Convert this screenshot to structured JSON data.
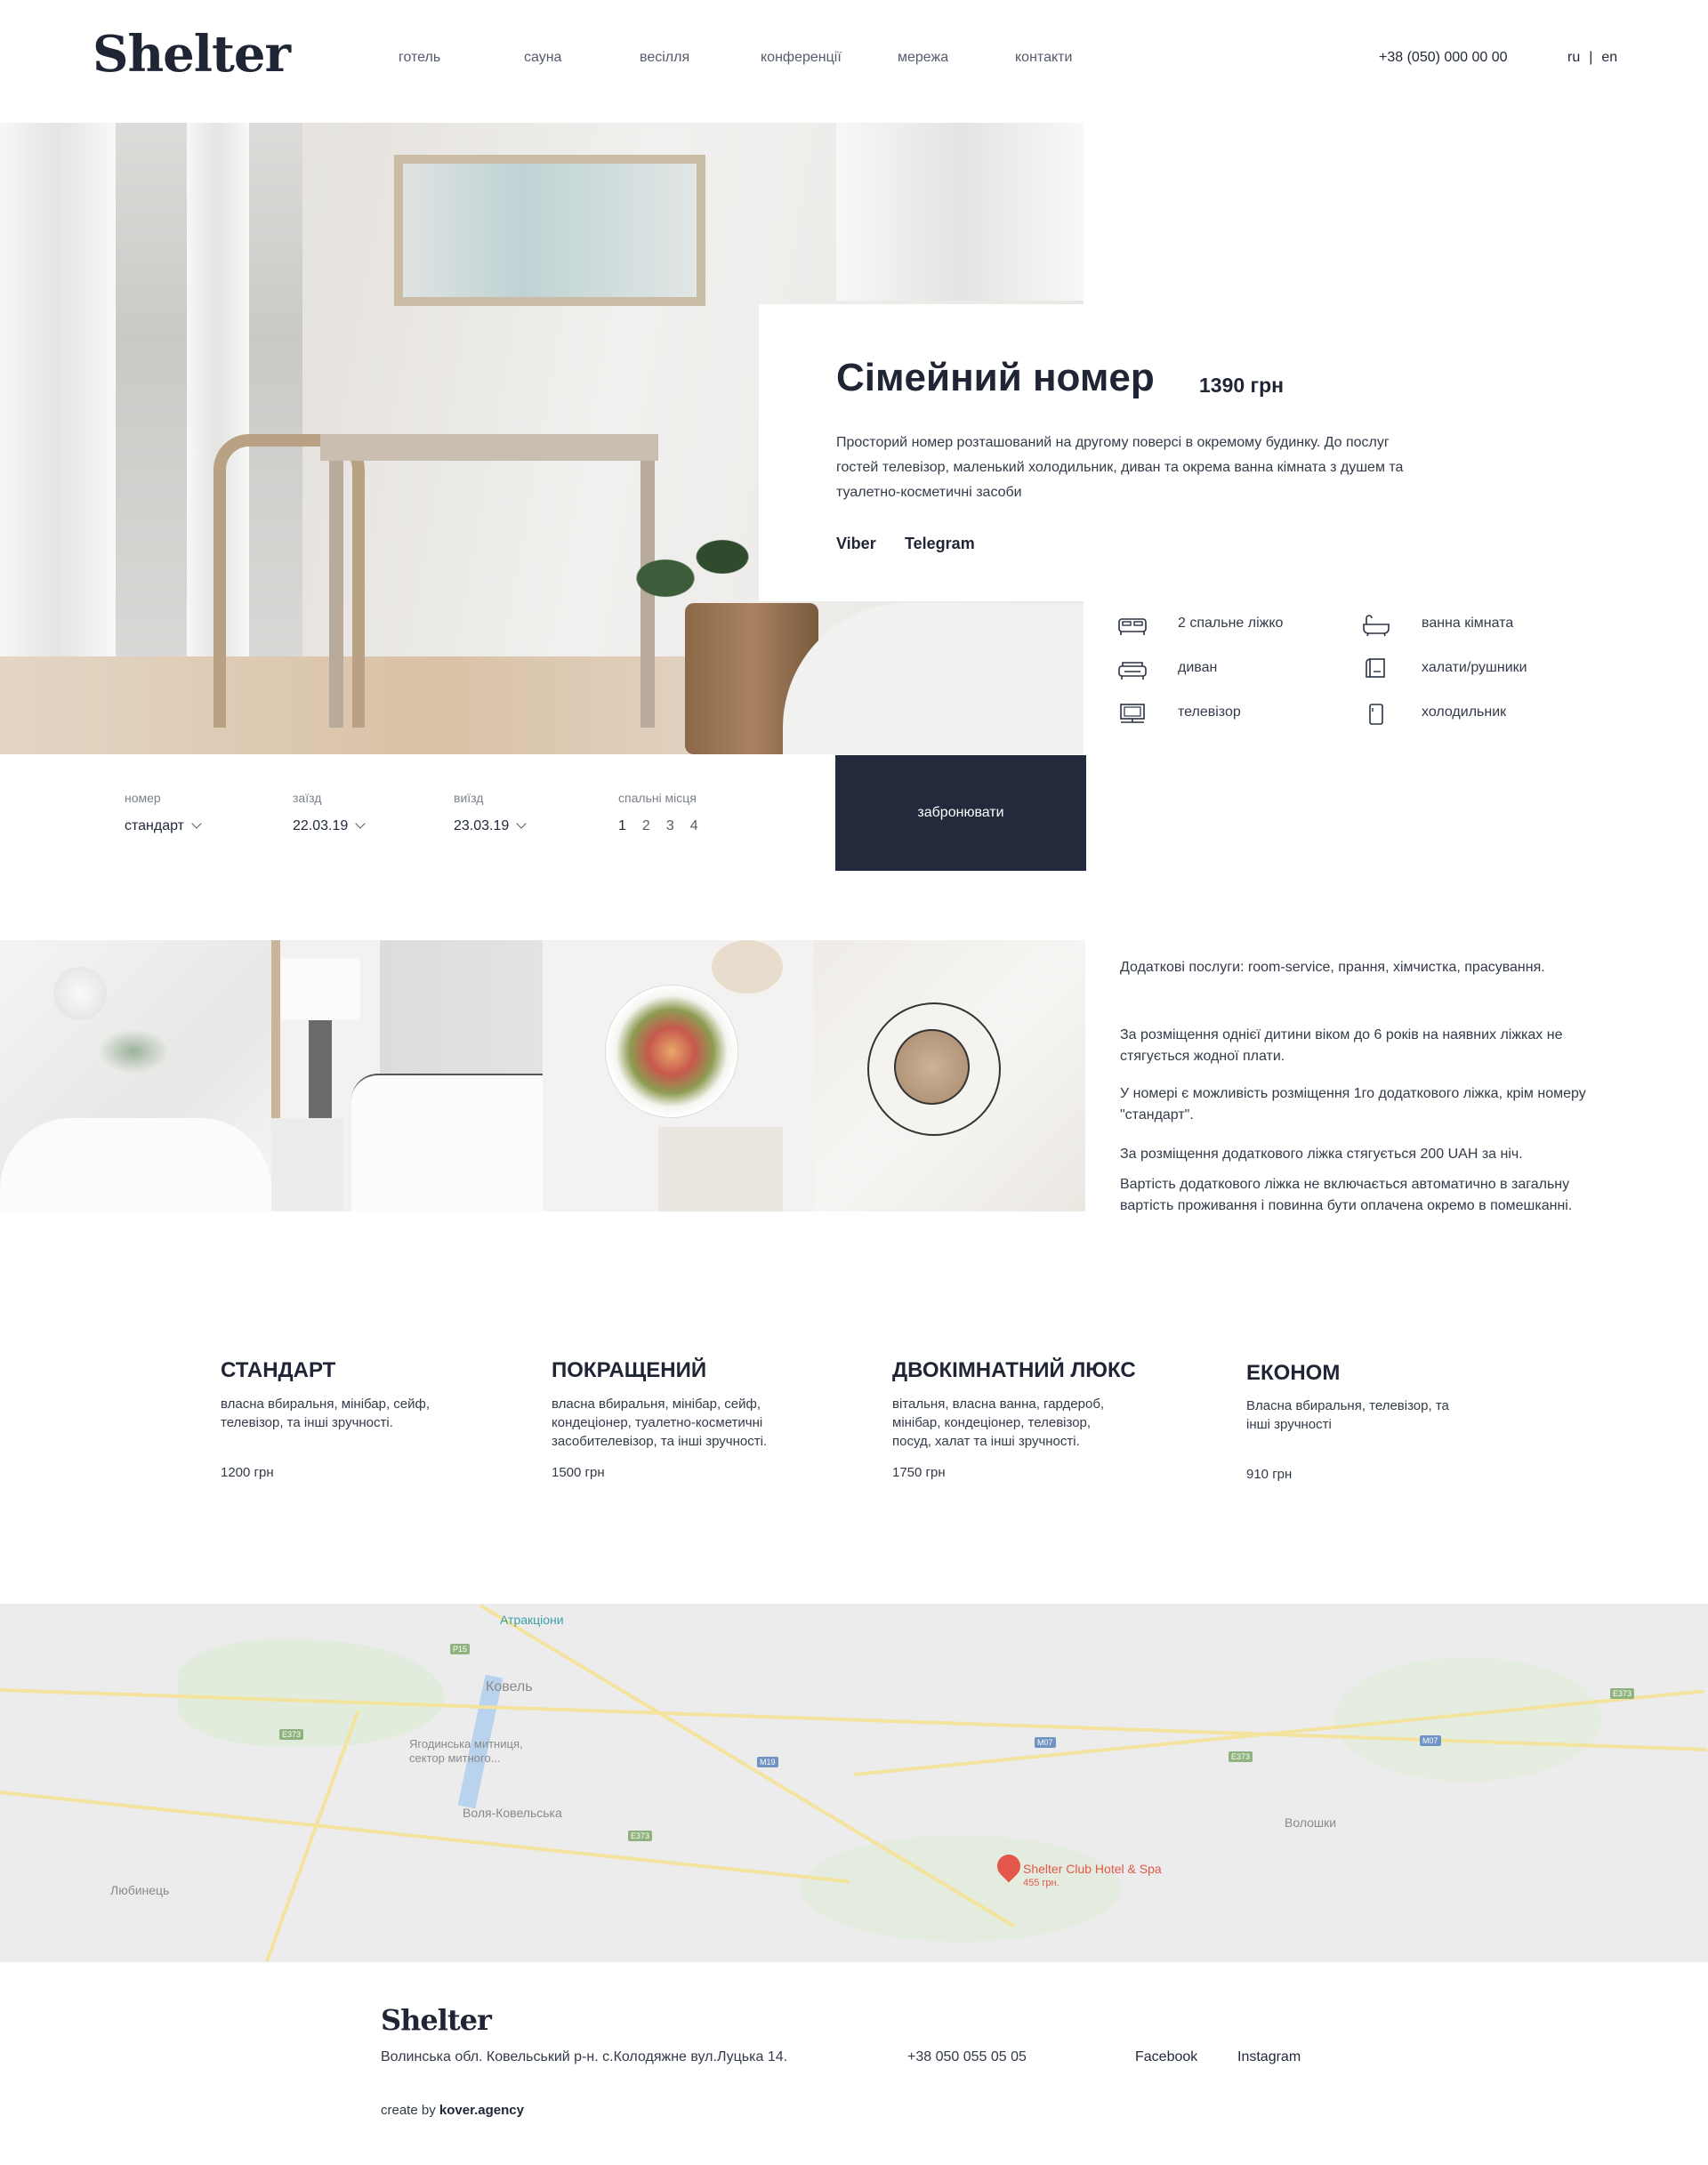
{
  "header": {
    "logo": "Shelter",
    "nav": [
      "готель",
      "сауна",
      "весілля",
      "конференції",
      "мережа",
      "контакти"
    ],
    "phone": "+38 (050) 000 00 00",
    "lang": {
      "ru": "ru",
      "sep": "|",
      "en": "en"
    }
  },
  "room": {
    "title": "Сімейний номер",
    "price": "1390 грн",
    "description": "Просторий номер розташований на другому поверсі в окремому будинку. До послуг гостей телевізор, маленький холодильник, диван та окрема ванна кімната з душем та туалетно-косметичні засоби",
    "messengers": [
      "Viber",
      "Telegram"
    ]
  },
  "amenities": [
    {
      "icon": "double-bed-icon",
      "label": "2 спальне ліжко"
    },
    {
      "icon": "bathtub-icon",
      "label": "ванна кімната"
    },
    {
      "icon": "sofa-icon",
      "label": "диван"
    },
    {
      "icon": "towel-icon",
      "label": "халати/рушники"
    },
    {
      "icon": "tv-icon",
      "label": "телевізор"
    },
    {
      "icon": "fridge-icon",
      "label": "холодильник"
    }
  ],
  "booking": {
    "room_label": "номер",
    "room_value": "стандарт",
    "checkin_label": "заїзд",
    "checkin_value": "22.03.19",
    "checkout_label": "виїзд",
    "checkout_value": "23.03.19",
    "beds_label": "спальні місця",
    "beds": [
      "1",
      "2",
      "3",
      "4"
    ],
    "button": "забронювати"
  },
  "extras": [
    "Додаткові послуги: room-service, прання, хімчистка, прасування.",
    "За розміщення однієї дитини віком до 6 років на наявних ліжках не стягується жодної плати.",
    "У номері є можливість розміщення 1го додаткового ліжка, крім номеру \"стандарт\".",
    "За розміщення додаткового ліжка стягується 200 UAH за ніч.",
    "Вартість додаткового ліжка не включається автоматично в загальну вартість проживання і повинна бути оплачена окремо в помешканні."
  ],
  "room_types": [
    {
      "title": "СТАНДАРТ",
      "desc": "власна вбиральня,  мінібар, сейф, телевізор, та інші зручності.",
      "price": "1200 грн"
    },
    {
      "title": "ПОКРАЩЕНИЙ",
      "desc": "власна вбиральня,  мінібар, сейф, кондеціонер, туалетно-косметичні засобителевізор, та інші зручності.",
      "price": "1500 грн"
    },
    {
      "title": "ДВОКІМНАТНИЙ ЛЮКС",
      "desc": "вітальня, власна ванна,  гардероб, мінібар, кондеціонер, телевізор, посуд, халат та інші зручності.",
      "price": "1750 грн"
    },
    {
      "title": "ЕКОНОМ",
      "desc": "Власна вбиральня, телевізор, та інші зручності",
      "price": "910 грн"
    }
  ],
  "map": {
    "places": [
      "Атракціони",
      "Ковель",
      "Ягодинська митниця, сектор митного...",
      "Воля-Ковельська",
      "Любинець",
      "Волошки"
    ],
    "roads": [
      "P15",
      "E373",
      "M19",
      "E373",
      "M07",
      "E373",
      "M07",
      "E373"
    ],
    "marker_title": "Shelter Club Hotel & Spa",
    "marker_sub": "455 грн."
  },
  "footer": {
    "logo": "Shelter",
    "address": "Волинська обл. Ковельський р-н. с.Колодяжне вул.Луцька 14.",
    "phone": "+38 050 055 05 05",
    "links": [
      "Facebook",
      "Instagram"
    ],
    "credit_prefix": "create by",
    "credit_agency": "kover.agency"
  }
}
